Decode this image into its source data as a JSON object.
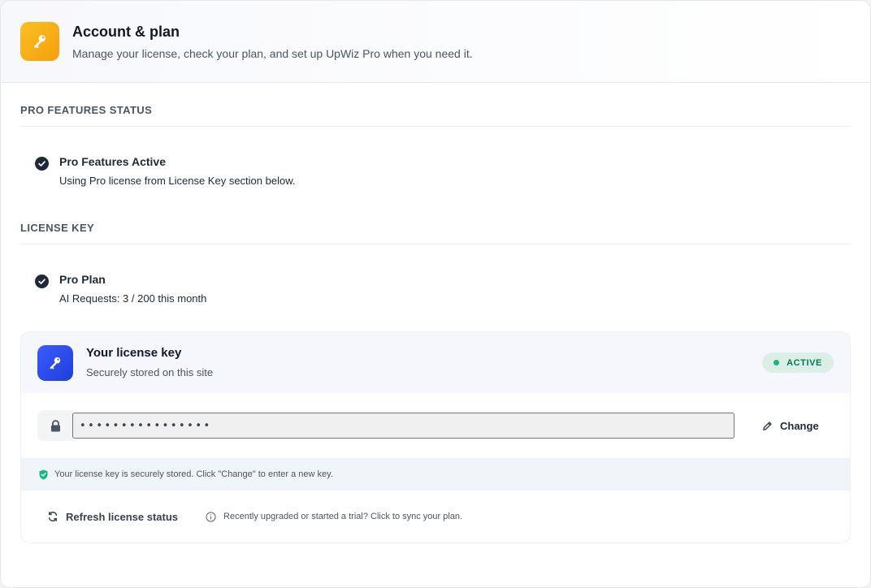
{
  "header": {
    "title": "Account & plan",
    "subtitle": "Manage your license, check your plan, and set up UpWiz Pro when you need it.",
    "icon": "key-icon"
  },
  "pro_status": {
    "section_title": "PRO FEATURES STATUS",
    "title": "Pro Features Active",
    "description": "Using Pro license from License Key section below."
  },
  "license": {
    "section_title": "LICENSE KEY",
    "plan_title": "Pro Plan",
    "usage": "AI Requests: 3 / 200 this month"
  },
  "key_card": {
    "title": "Your license key",
    "subtitle": "Securely stored on this site",
    "badge": "ACTIVE",
    "key_value": "••••••••••••••••",
    "change_label": "Change",
    "notice": "Your license key is securely stored. Click \"Change\" to enter a new key.",
    "refresh_label": "Refresh license status",
    "refresh_hint": "Recently upgraded or started a trial? Click to sync your plan."
  },
  "colors": {
    "accent_orange": "#f59e0b",
    "accent_blue": "#2546f0",
    "active_green": "#10b981"
  }
}
